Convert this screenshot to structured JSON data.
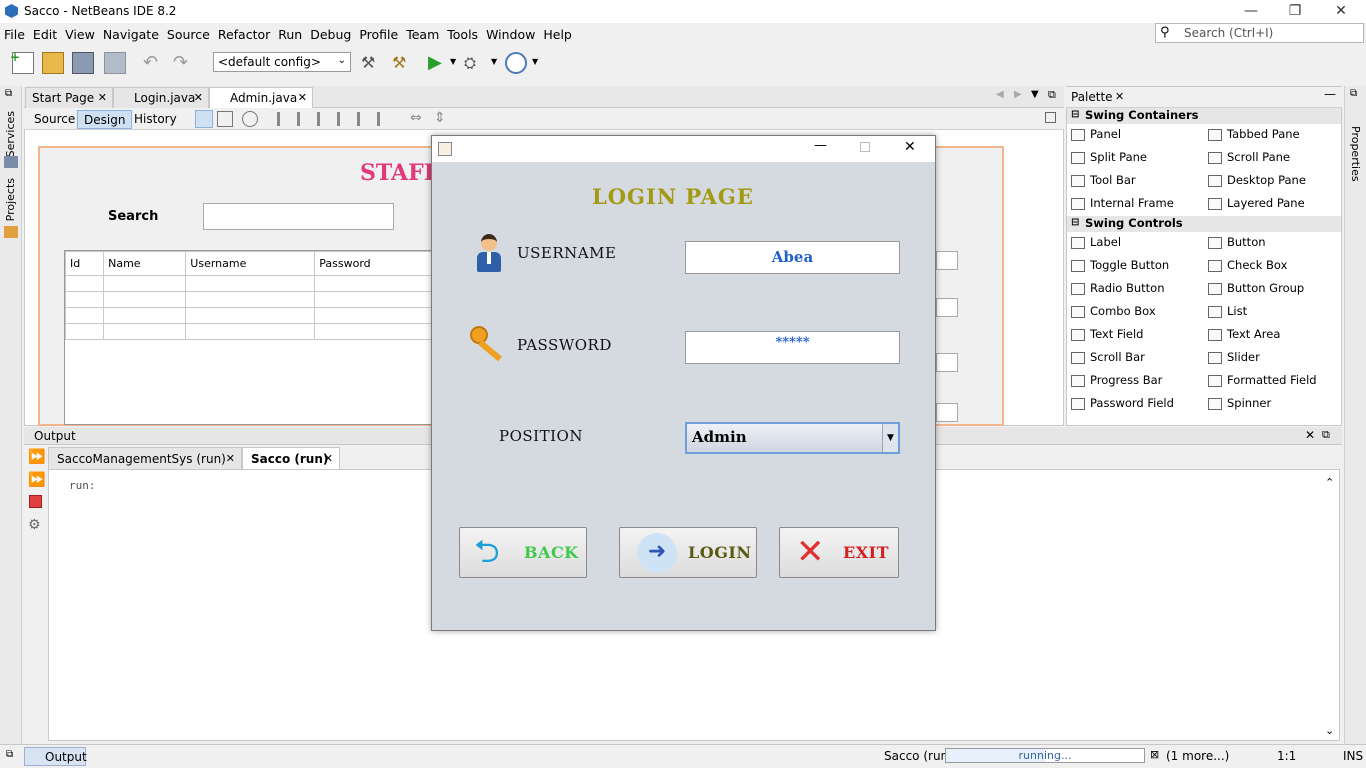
{
  "window": {
    "title": "Sacco - NetBeans IDE 8.2"
  },
  "menu": [
    "File",
    "Edit",
    "View",
    "Navigate",
    "Source",
    "Refactor",
    "Run",
    "Debug",
    "Profile",
    "Team",
    "Tools",
    "Window",
    "Help"
  ],
  "search": {
    "placeholder": "Search (Ctrl+I)"
  },
  "toolbar": {
    "config": "<default config>"
  },
  "sidebar_left": {
    "services": "Services",
    "projects": "Projects"
  },
  "sidebar_right": {
    "properties": "Properties"
  },
  "editor": {
    "tabs": [
      "Start Page",
      "Login.java",
      "Admin.java"
    ],
    "design_buttons": [
      "Source",
      "Design",
      "History"
    ]
  },
  "canvas": {
    "title": "STAFF",
    "search_label": "Search",
    "table_headers": [
      "Id",
      "Name",
      "Username",
      "Password"
    ]
  },
  "palette": {
    "title": "Palette",
    "categories": [
      {
        "name": "Swing Containers",
        "items": [
          "Panel",
          "Tabbed Pane",
          "Split Pane",
          "Scroll Pane",
          "Tool Bar",
          "Desktop Pane",
          "Internal Frame",
          "Layered Pane"
        ]
      },
      {
        "name": "Swing Controls",
        "items": [
          "Label",
          "Button",
          "Toggle Button",
          "Check Box",
          "Radio Button",
          "Button Group",
          "Combo Box",
          "List",
          "Text Field",
          "Text Area",
          "Scroll Bar",
          "Slider",
          "Progress Bar",
          "Formatted Field",
          "Password Field",
          "Spinner"
        ]
      }
    ]
  },
  "output": {
    "title": "Output",
    "tabs": [
      "SaccoManagementSys (run)",
      "Sacco (run)"
    ],
    "text": "run:"
  },
  "status": {
    "task": "Sacco (run)",
    "progress_text": "running...",
    "progress": 0.5,
    "more": "(1 more...)",
    "position": "1:1",
    "mode": "INS",
    "output_tab": "Output"
  },
  "dialog": {
    "heading": "LOGIN PAGE",
    "username_label": "USERNAME",
    "username_value": "Abea",
    "password_label": "PASSWORD",
    "password_value": "*****",
    "position_label": "POSITION",
    "position_value": "Admin",
    "back_label": "BACK",
    "login_label": "LOGIN",
    "exit_label": "EXIT"
  },
  "colors": {
    "heading": "#a29a12",
    "back": "#3ec94a",
    "login": "#5a5a12",
    "exit": "#d42020",
    "canvas_title": "#e03a7a"
  }
}
